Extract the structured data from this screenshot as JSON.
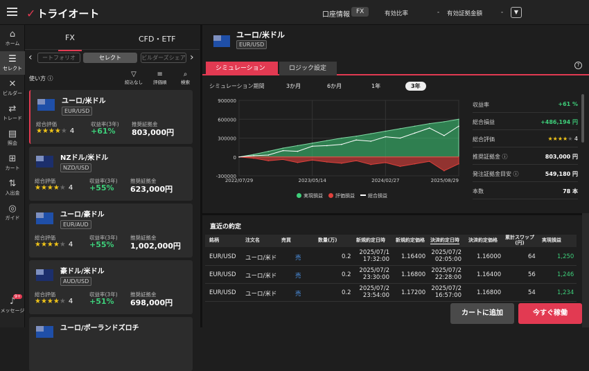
{
  "header": {
    "brand": "トライオート",
    "account_label": "口座情報",
    "account_type": "FX",
    "margin_ratio_label": "有効比率",
    "margin_ratio_value": "-",
    "margin_amount_label": "有効証拠金額",
    "margin_amount_value": "-"
  },
  "sidebar": {
    "items": [
      {
        "label": "ホーム",
        "icon": "home-icon"
      },
      {
        "label": "セレクト",
        "icon": "select-icon"
      },
      {
        "label": "ビルダー",
        "icon": "builder-icon"
      },
      {
        "label": "トレード",
        "icon": "trade-icon"
      },
      {
        "label": "照会",
        "icon": "inquiry-icon"
      },
      {
        "label": "カート",
        "icon": "cart-icon"
      },
      {
        "label": "入出金",
        "icon": "deposit-icon"
      },
      {
        "label": "ガイド",
        "icon": "guide-icon"
      }
    ],
    "message_label": "メッセージ",
    "message_badge": "9+"
  },
  "left": {
    "tabs": [
      "FX",
      "CFD・ETF"
    ],
    "pills": [
      "ートフォリオ",
      "セレクト",
      "ビルダーズシェア"
    ],
    "howto": "使い方",
    "tools": [
      "絞込なし",
      "評価順",
      "検索"
    ],
    "labels": {
      "rating": "総合評価",
      "return": "収益率(3年)",
      "margin": "推奨証拠金"
    },
    "cards": [
      {
        "name": "ユーロ/米ドル",
        "code": "EUR/USD",
        "rating": "4",
        "return": "+61%",
        "margin": "803,000円"
      },
      {
        "name": "NZドル/米ドル",
        "code": "NZD/USD",
        "rating": "4",
        "return": "+55%",
        "margin": "623,000円"
      },
      {
        "name": "ユーロ/豪ドル",
        "code": "EUR/AUD",
        "rating": "4",
        "return": "+55%",
        "margin": "1,002,000円"
      },
      {
        "name": "豪ドル/米ドル",
        "code": "AUD/USD",
        "rating": "4",
        "return": "+51%",
        "margin": "698,000円"
      },
      {
        "name": "ユーロ/ポーランドズロチ",
        "code": "",
        "rating": "",
        "return": "",
        "margin": ""
      }
    ]
  },
  "right": {
    "title": "ユーロ/米ドル",
    "code": "EUR/USD",
    "tabs": [
      "シミュレーション",
      "ロジック設定"
    ],
    "period_label": "シミュレーション期間",
    "periods": [
      "3か月",
      "6か月",
      "1年",
      "3年"
    ],
    "selected_period": "3年",
    "stats": [
      {
        "k": "収益率",
        "v": "+61 %"
      },
      {
        "k": "総合損益",
        "v": "+486,194 円"
      },
      {
        "k": "総合評価",
        "v": "4"
      },
      {
        "k": "推奨証拠金",
        "v": "803,000 円"
      },
      {
        "k": "発注証拠金目安",
        "v": "549,180 円"
      },
      {
        "k": "本数",
        "v": "78 本"
      }
    ],
    "legend": [
      "実現損益",
      "評価損益",
      "総合損益"
    ],
    "orders_title": "直近の約定",
    "columns": [
      "銘柄",
      "注文名",
      "売買",
      "数量(万)",
      "新規約定日時",
      "新規約定価格",
      "決済約定日時",
      "決済約定価格",
      "累計スワップ(円)",
      "実現損益"
    ],
    "rows": [
      {
        "pair": "EUR/USD",
        "name": "ユーロ/米ド",
        "side": "売",
        "qty": "0.2",
        "open_dt1": "2025/07/1",
        "open_dt2": "17:32:00",
        "open_price": "1.16400",
        "close_dt1": "2025/07/2",
        "close_dt2": "02:05:00",
        "close_price": "1.16000",
        "swap": "64",
        "pnl": "1,250"
      },
      {
        "pair": "EUR/USD",
        "name": "ユーロ/米ド",
        "side": "売",
        "qty": "0.2",
        "open_dt1": "2025/07/2",
        "open_dt2": "23:30:00",
        "open_price": "1.16800",
        "close_dt1": "2025/07/2",
        "close_dt2": "22:28:00",
        "close_price": "1.16400",
        "swap": "56",
        "pnl": "1,246"
      },
      {
        "pair": "EUR/USD",
        "name": "ユーロ/米ド",
        "side": "売",
        "qty": "0.2",
        "open_dt1": "2025/07/2",
        "open_dt2": "23:54:00",
        "open_price": "1.17200",
        "close_dt1": "2025/07/2",
        "close_dt2": "16:57:00",
        "close_price": "1.16800",
        "swap": "54",
        "pnl": "1,234"
      }
    ],
    "buttons": {
      "cart": "カートに追加",
      "run": "今すぐ稼働"
    }
  },
  "colors": {
    "accent": "#e23a52",
    "profit": "#3ecf7a",
    "loss": "#e0413c"
  },
  "chart_data": {
    "type": "area",
    "x_ticks": [
      "2022/07/29",
      "2023/05/14",
      "2024/02/27",
      "2025/08/29"
    ],
    "y_ticks": [
      "900000",
      "600000",
      "300000",
      "0",
      "-300000"
    ],
    "ylim": [
      -300000,
      900000
    ],
    "series": [
      {
        "name": "実現損益",
        "values": [
          0,
          40000,
          90000,
          140000,
          180000,
          220000,
          260000,
          300000,
          330000,
          370000,
          410000,
          450000,
          490000,
          530000,
          560000,
          600000
        ]
      },
      {
        "name": "評価損益",
        "values": [
          0,
          -20000,
          -60000,
          -40000,
          -90000,
          -50000,
          -80000,
          -100000,
          -60000,
          -120000,
          -90000,
          -150000,
          -110000,
          -70000,
          -220000,
          -110000
        ]
      },
      {
        "name": "総合損益",
        "values": [
          0,
          20000,
          30000,
          100000,
          90000,
          170000,
          180000,
          200000,
          270000,
          250000,
          320000,
          300000,
          380000,
          460000,
          340000,
          490000
        ]
      }
    ]
  }
}
